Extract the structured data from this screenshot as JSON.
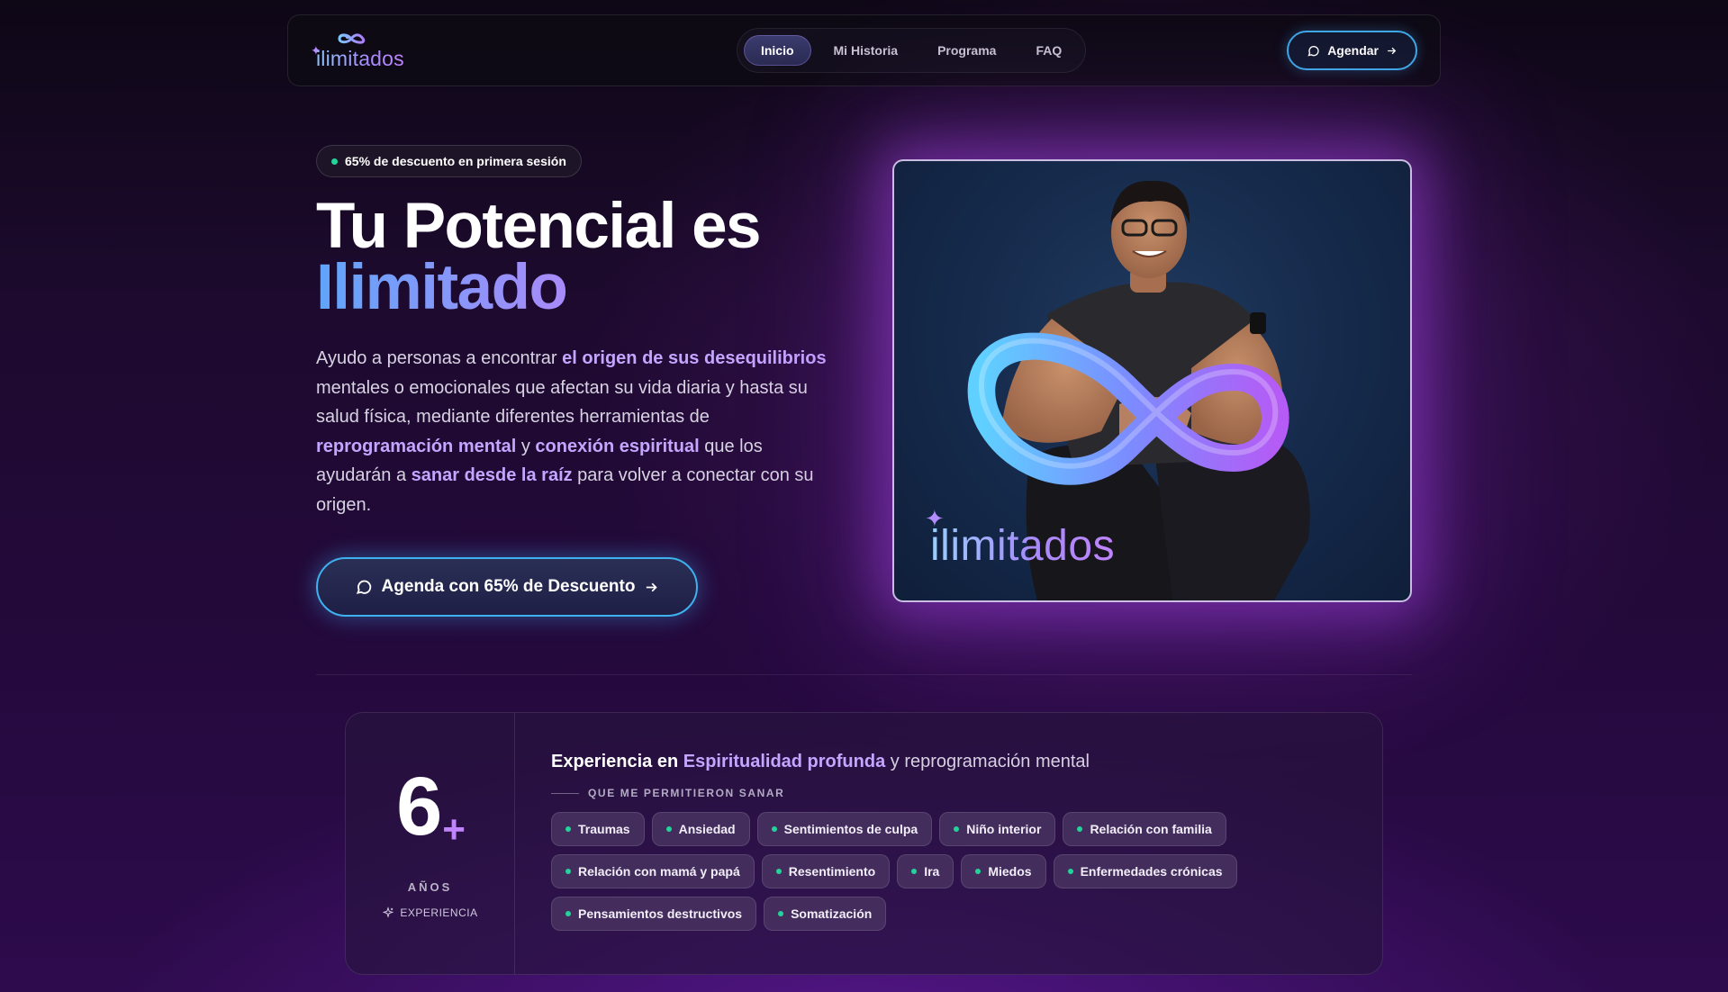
{
  "brand": {
    "name": "ilimitados"
  },
  "nav": {
    "items": [
      {
        "label": "Inicio",
        "active": true
      },
      {
        "label": "Mi Historia",
        "active": false
      },
      {
        "label": "Programa",
        "active": false
      },
      {
        "label": "FAQ",
        "active": false
      }
    ],
    "cta_label": "Agendar"
  },
  "hero": {
    "badge": "65% de descuento en primera sesión",
    "title_line1": "Tu Potencial es",
    "title_line2": "Ilimitado",
    "description": {
      "p1": "Ayudo a personas a encontrar ",
      "h1": "el origen de sus desequilibrios",
      "p2": " mentales o emocionales que afectan su vida diaria y hasta su salud física, mediante diferentes herramientas de ",
      "h2": "reprogramación mental",
      "p3": " y ",
      "h3": "conexión espiritual",
      "p4": " que los ayudarán a ",
      "h4": "sanar desde la raíz",
      "p5": " para volver a conectar con su origen."
    },
    "cta_label": "Agenda con 65% de Descuento",
    "image_logo": "ilimitados"
  },
  "stats": {
    "number": "6",
    "plus": "+",
    "unit": "AÑOS",
    "caption": "EXPERIENCIA",
    "heading_bold": "Experiencia en",
    "heading_accent": "Espiritualidad profunda",
    "heading_rest": "y reprogramación mental",
    "subheading": "QUE ME PERMITIERON SANAR",
    "tags": [
      "Traumas",
      "Ansiedad",
      "Sentimientos de culpa",
      "Niño interior",
      "Relación con familia",
      "Relación con mamá y papá",
      "Resentimiento",
      "Ira",
      "Miedos",
      "Enfermedades crónicas",
      "Pensamientos destructivos",
      "Somatización"
    ]
  },
  "colors": {
    "accent_purple": "#c4a5ff",
    "accent_blue": "#3fb1ef",
    "status_green": "#22d39a",
    "bg_dark": "#0e0716"
  },
  "icons": {
    "logo": "infinity-logo-icon",
    "chat": "chat-bubble-icon",
    "arrow": "arrow-right-icon",
    "sparkle": "sparkle-icon"
  }
}
